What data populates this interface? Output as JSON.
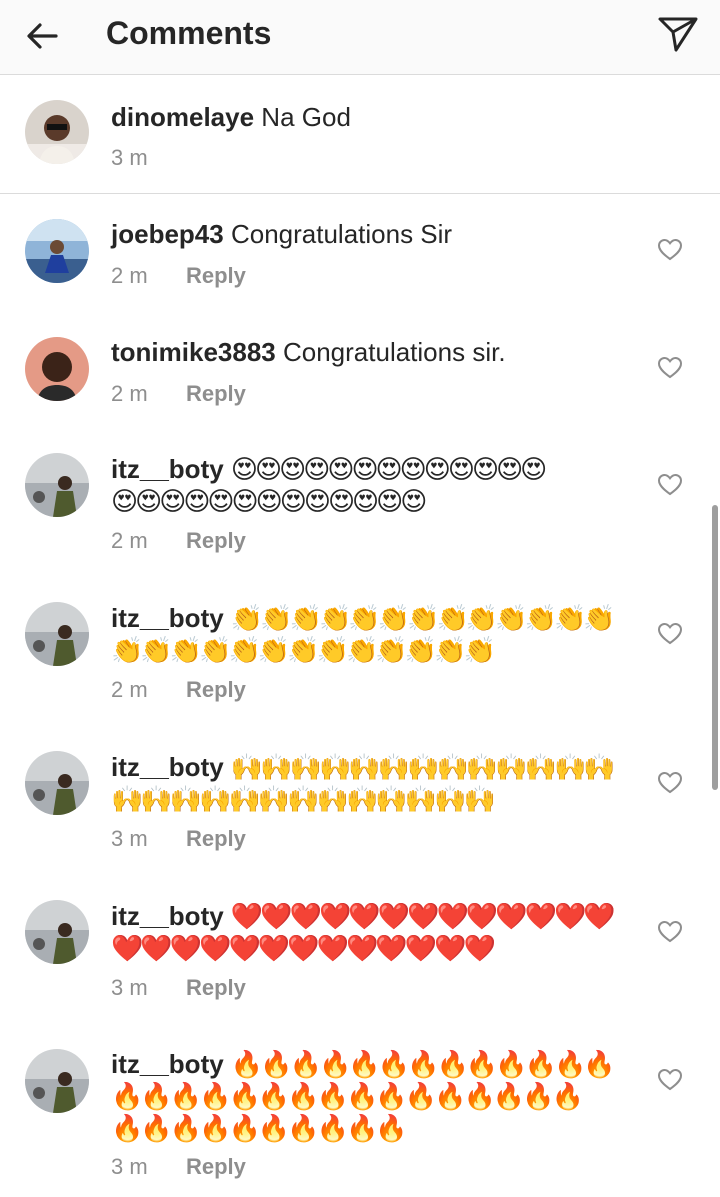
{
  "header": {
    "title": "Comments"
  },
  "caption": {
    "username": "dinomelaye",
    "text": "Na God",
    "time": "3 m"
  },
  "comments": [
    {
      "username": "joebep43",
      "text": "Congratulations Sir",
      "time": "2 m",
      "reply": "Reply"
    },
    {
      "username": "tonimike3883",
      "text": "Congratulations sir.",
      "time": "2 m",
      "reply": "Reply"
    },
    {
      "username": "itz__boty",
      "line1": "😍😍😍😍😍😍😍😍😍😍😍😍😍",
      "line2": "😍😍😍😍😍😍😍😍😍😍😍😍😍",
      "time": "2 m",
      "reply": "Reply"
    },
    {
      "username": "itz__boty",
      "line1": "👏👏👏👏👏👏👏👏👏👏👏👏👏",
      "line2": "👏👏👏👏👏👏👏👏👏👏👏👏👏",
      "time": "2 m",
      "reply": "Reply"
    },
    {
      "username": "itz__boty",
      "line1": "🙌🙌🙌🙌🙌🙌🙌🙌🙌🙌🙌🙌🙌",
      "line2": "🙌🙌🙌🙌🙌🙌🙌🙌🙌🙌🙌🙌🙌",
      "time": "3 m",
      "reply": "Reply"
    },
    {
      "username": "itz__boty",
      "line1": "❤️❤️❤️❤️❤️❤️❤️❤️❤️❤️❤️❤️❤️",
      "line2": "❤️❤️❤️❤️❤️❤️❤️❤️❤️❤️❤️❤️❤️",
      "time": "3 m",
      "reply": "Reply"
    },
    {
      "username": "itz__boty",
      "line1": "🔥🔥🔥🔥🔥🔥🔥🔥🔥🔥🔥🔥🔥",
      "line2": "🔥🔥🔥🔥🔥🔥🔥🔥🔥🔥🔥🔥🔥🔥🔥🔥",
      "line3": "🔥🔥🔥🔥🔥🔥🔥🔥🔥🔥",
      "time": "3 m",
      "reply": "Reply"
    }
  ],
  "icons": {
    "back": "arrow-left-icon",
    "send": "send-icon",
    "like": "heart-outline-icon"
  }
}
